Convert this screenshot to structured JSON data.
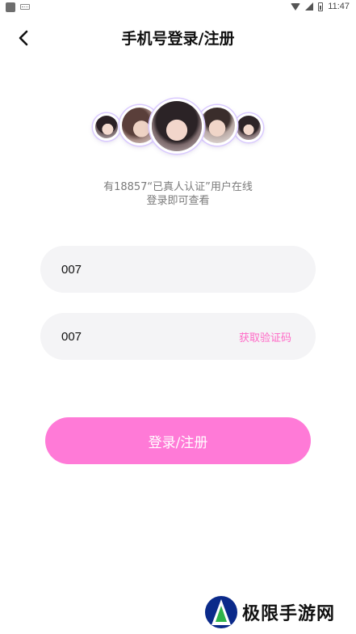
{
  "status_bar": {
    "time": "11:47",
    "icons": [
      "app-notification-icon",
      "keyboard-icon",
      "wifi-icon",
      "cellular-icon",
      "battery-icon"
    ]
  },
  "header": {
    "title": "手机号登录/注册",
    "back_icon": "chevron-left-icon"
  },
  "online_info": {
    "line1": "有18857“已真人认证”用户在线",
    "line2": "登录即可查看"
  },
  "form": {
    "phone_value": "007",
    "code_value": "007",
    "get_code_label": "获取验证码"
  },
  "login_button_label": "登录/注册",
  "watermark": {
    "text": "极限手游网"
  },
  "colors": {
    "accent_pink": "#ff7ad7",
    "link_pink": "#ff69c6",
    "field_bg": "#f4f4f6",
    "avatar_ring": "#d9c9ff"
  }
}
